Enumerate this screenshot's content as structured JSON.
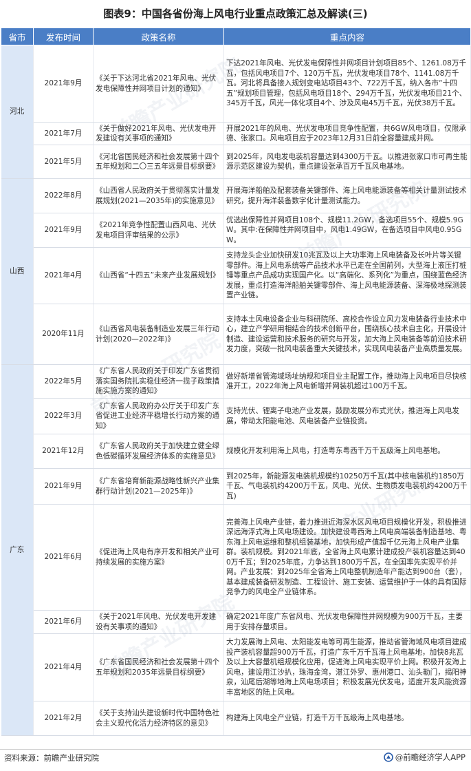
{
  "title": "图表9：中国各省份海上风电行业重点政策汇总及解读(三)",
  "headers": [
    "省市",
    "发布时间",
    "政策名称",
    "重点内容"
  ],
  "provinces": {
    "hebei": "河北",
    "shanxi": "山西",
    "guangdong": "广东"
  },
  "rows": [
    {
      "date": "2021年9月",
      "name": "《关于下达河北省2021年风电、光伏发电保障性并网项目计划的通知》",
      "content": "下达2021年风电、光伏发电保障性并网项目计划项目85个、1261.08万千瓦，包括风电项目7个、120万千瓦，光伏发电项目78个、1141.08万千瓦。河北将具备接入规划变电站项目43个、722万千瓦，纳入各市“十四五”规划项目管理，包括风电项目18个、294万千瓦，光伏发电项目21个、345万千瓦，风光一体化项目4个、涉及风电45万千瓦，光伏38万千瓦。"
    },
    {
      "date": "2021年7月",
      "name": "《关于做好2021年风电、光伏发电开发建设有关事项的通知》",
      "content": "开展2021年的风电、光伏发电项目竞争性配置，共6GW风电项目，仅限承德、张家口。风电项目应于2023年12月31日前全容量建成并网。"
    },
    {
      "date": "2021年5月",
      "name": "《河北省国民经济和社会发展第十四个五年规划和二〇三五年远景目标纲要》",
      "content": "到2025年，风电发电装机容量达到4300万千瓦。以推进张家口市可再生能源示范区建设为契机，重点建设张承百万千瓦风电基地。"
    },
    {
      "date": "2022年8月",
      "name": "《山西省人民政府关于贯彻落实计量发展规划(2021—2035年)的实施意见》",
      "content": "开展海洋船舶及配套装备关键部件、海上风电能源装备等相关计量测试技术研究，提升海洋装备数字化计量测试能力。"
    },
    {
      "date": "2021年9月",
      "name": "《2021年竞争性配置山西风电、光伏发电项目评审结果的公示》",
      "content": "优选出保障性并网项目108个、规模11.2GW，备选项目55个、规模5.9GW。其中:在保障性并网项目中，风电1.49GW，在备选项目中风电0.95GW。"
    },
    {
      "date": "2021年4月",
      "name": "《山西省“十四五”未来产业发展规划》",
      "content": "支持龙头企业加快研发10兆瓦及以上大功率海上风电装备及长叶片等关键零部件。海上风电系统等产品技术水平已走在全国前列，大型海上液压打桩锤等重点产品成功实现国产化。以“高端化、系列化”为重点，围绕蓝色经济发展，重点打造海洋船舶关键零部件、海上风电能源装备、深海极地探测装置产业链。"
    },
    {
      "date": "2020年11月",
      "name": "《山西省风电装备制造业发展三年行动计划(2020—2022年)》",
      "content": "支持本土风电设备企业与科研院所、高校合作设立风力发电装备行业技术中心，建立产学研用相结合的技术创新平台，围绕核心技术自主化，开展设计制造、建设运营和技术服务的研究与开发，加大海上风电装备等前沿技术研发力度，突破一批风电装备重大关键技术，实现风电装备产业高质量发展。"
    },
    {
      "date": "2022年5月",
      "name": "《广东省人民政府关于印发广东省贯彻落实国务院扎实稳住经济一揽子政策措施实施方案的通知》",
      "content": "做好新增省管海域场址纳规和项目业主配置工作，推动海上风电项目尽快核准开工，2022年海上风电新增并网装机超过100万千瓦。"
    },
    {
      "date": "2022年3月",
      "name": "《广东省人民政府办公厅关于印发广东省促进工业经济平稳增长行动方案的通知》",
      "content": "支持光伏、锂离子电池产业发展，鼓励发展分布式光伏，推进海上风电发展，带动太阳能电池、风电装备产业链投资。"
    },
    {
      "date": "2021年12月",
      "name": "《广东省人民政府关于加快建立健全绿色低碳循环发展经济体系的实施意见》",
      "content": "规模化开发利用海上风电，打造粤东粤西千万千瓦级海上风电基地。"
    },
    {
      "date": "2021年9月",
      "name": "《广东省培育新能源战略性新兴产业集群行动计划(2021—2025年)》",
      "content": "到2025年，新能源发电装机规模约10250万千瓦(其中核电装机约1850万千瓦、气电装机约4200万千瓦，风电、光伏、生物质发电装机约4200万千瓦)"
    },
    {
      "date": "2021年6月",
      "name": "《促进海上风电有序开发和相关产业可持续发展的实施方案》",
      "content": "完善海上风电产业链，着力推进近海深水区风电项目规模化开发，积极推进深远海浮式海上风电场建设。加快建设粤西海上风电高端装备制造基地、粤东海上风电运维和整机组装基地，加快形成产值超千亿元海上风电产业集群。装机规模。到2021年底，全省海上风电累计建成投产装机容量达到400万千瓦；到2025年底，力争达到1800万千瓦，在全国率先实现平价并网。产业发展：到2025年全省海上风电整机制造年产能达到900台（套），基本建成装备研发制造、工程设计、施工安装、运营维护于一体的具有国际竞争力的风电全产业链体系。"
    },
    {
      "date": "2021年6月",
      "name": "《关于2021年风电、光伏发电开发建设有关事项的通知》",
      "content": "确定2021年度广东省风电、光伏发电保障性并网规模为900万千瓦，主要用于安排存量项目。"
    },
    {
      "date": "2021年4月",
      "name": "《广东省国民经济和社会发展第十四个五年规划和2035年远景目标纲要》",
      "content": "大力发展海上风电、太阳能发电等可再生能源，推动省管海域风电项目建成投产装机容量超900万千瓦，打造广东千万千瓦海上风电基地，加快8兆瓦及以上大容量机组规模化应用，促进海上风电实现平价上网。积极开发海上风电，建设用江沙扒，珠海金湾，湛江外罗、惠州港口、汕头勒门，揭阳神泉，汕尾后湖等地海上风电场项目；积极发展光伏发电，适度开发风能资源丰富地区的陆上风电。"
    },
    {
      "date": "2021年2月",
      "name": "《关于支持汕头建设新时代中国特色社会主义现代化活力经济特区的意见》",
      "content": "构建海上风电全产业链，打造千万千瓦级海上风电基地。"
    }
  ],
  "watermark": "前瞻产业研究院",
  "footer": {
    "source": "资料来源：前瞻产业研究院",
    "brand": "@前瞻经济学人APP"
  },
  "colors": {
    "header_bg": "#4a7ec6",
    "province_bg": "#dbe7f7"
  }
}
